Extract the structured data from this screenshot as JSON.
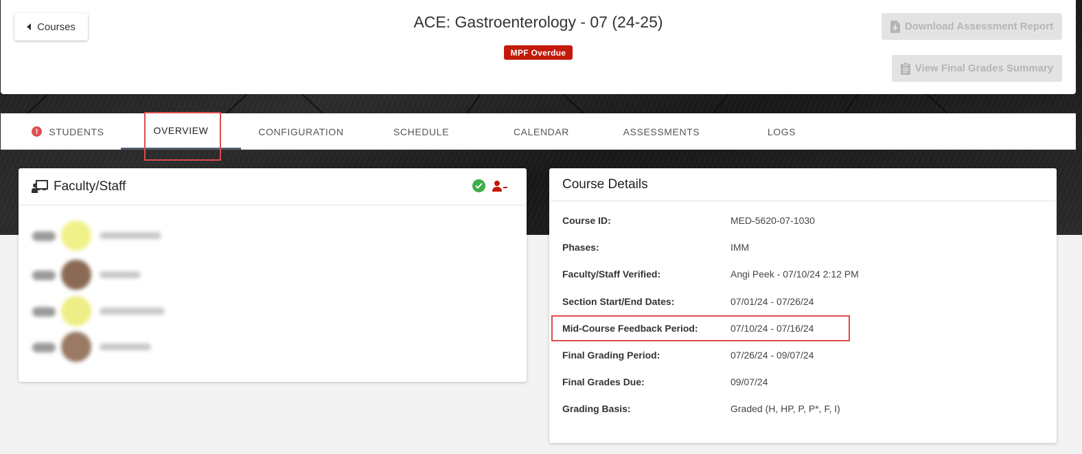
{
  "header": {
    "back_label": "Courses",
    "title": "ACE: Gastroenterology - 07 (24-25)",
    "badge": "MPF Overdue",
    "download_label": "Download Assessment Report",
    "grades_label": "View Final Grades Summary"
  },
  "tabs": [
    {
      "label": "STUDENTS",
      "icon": "alert-icon"
    },
    {
      "label": "OVERVIEW",
      "active": true
    },
    {
      "label": "CONFIGURATION"
    },
    {
      "label": "SCHEDULE"
    },
    {
      "label": "CALENDAR"
    },
    {
      "label": "ASSESSMENTS"
    },
    {
      "label": "LOGS"
    }
  ],
  "faculty": {
    "title": "Faculty/Staff",
    "rows": [
      {
        "avatar_color": "#f1f18a"
      },
      {
        "avatar_color": "#8b6a55"
      },
      {
        "avatar_color": "#eeee86"
      },
      {
        "avatar_color": "#9a7a62"
      }
    ]
  },
  "course_details": {
    "title": "Course Details",
    "rows": [
      {
        "label": "Course ID:",
        "value": "MED-5620-07-1030"
      },
      {
        "label": "Phases:",
        "value": "IMM"
      },
      {
        "label": "Faculty/Staff Verified:",
        "value": "Angi Peek - 07/10/24 2:12 PM"
      },
      {
        "label": "Section Start/End Dates:",
        "value": "07/01/24 - 07/26/24"
      },
      {
        "label": "Mid-Course Feedback Period:",
        "value": "07/10/24 - 07/16/24"
      },
      {
        "label": "Final Grading Period:",
        "value": "07/26/24 - 09/07/24"
      },
      {
        "label": "Final Grades Due:",
        "value": "09/07/24"
      },
      {
        "label": "Grading Basis:",
        "value": "Graded (H, HP, P, P*, F, I)"
      }
    ]
  },
  "colors": {
    "badge": "#c31a0b",
    "highlight_box": "#e04b4b",
    "verified": "#3fae48",
    "remove_user": "#c31a0b"
  }
}
